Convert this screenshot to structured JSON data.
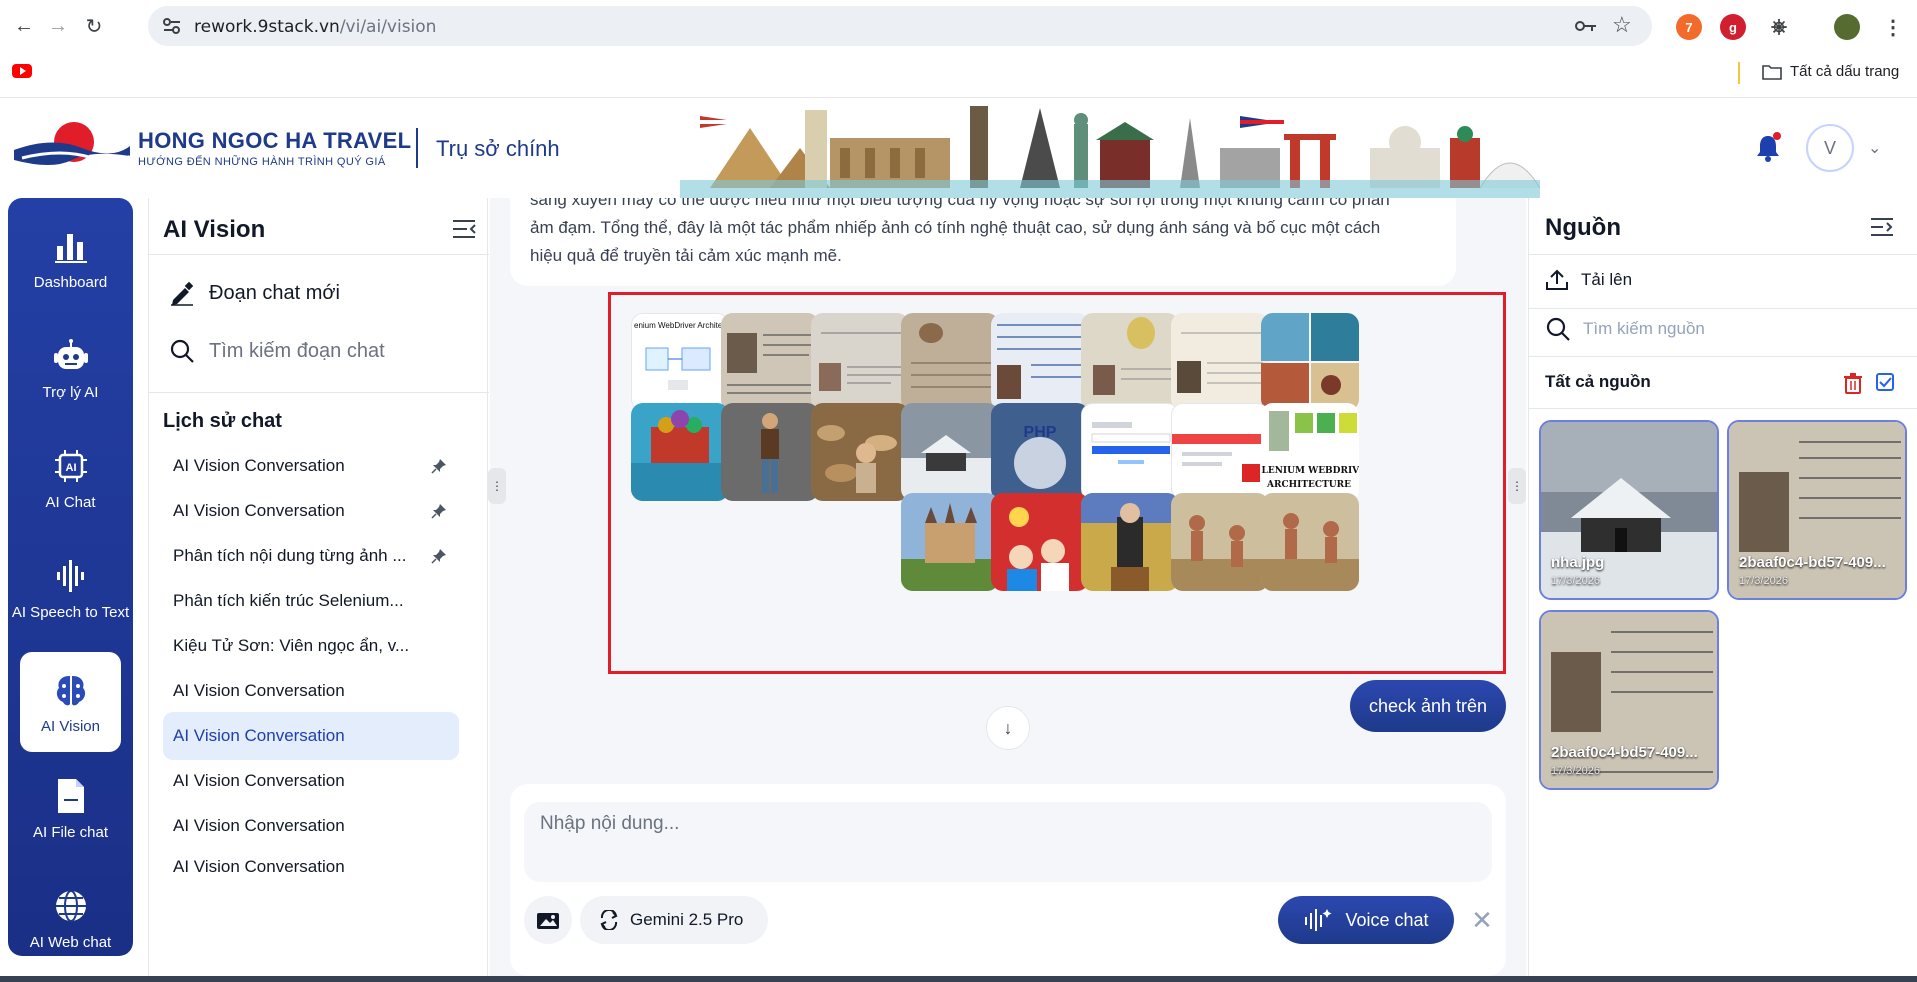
{
  "browser": {
    "url_host": "rework.9stack.vn",
    "url_path": "/vi/ai/vision",
    "bookmarks_all": "Tất cả dấu trang"
  },
  "header": {
    "brand_name": "HONG NGOC HA TRAVEL",
    "brand_tagline": "HƯỚNG ĐẾN NHỮNG HÀNH TRÌNH QUÝ GIÁ",
    "office": "Trụ sở chính",
    "avatar_initial": "V"
  },
  "leftnav": {
    "items": [
      {
        "label": "Dashboard",
        "icon": "bar-chart-icon"
      },
      {
        "label": "Trợ lý AI",
        "icon": "robot-icon"
      },
      {
        "label": "AI Chat",
        "icon": "ai-chip-icon"
      },
      {
        "label": "AI Speech to Text",
        "icon": "soundwave-icon"
      },
      {
        "label": "AI Vision",
        "icon": "brain-icon",
        "active": true
      },
      {
        "label": "AI File chat",
        "icon": "file-icon"
      },
      {
        "label": "AI Web chat",
        "icon": "globe-icon"
      }
    ]
  },
  "chatpanel": {
    "title": "AI Vision",
    "new_chat": "Đoạn chat mới",
    "search_placeholder": "Tìm kiếm đoạn chat",
    "history_title": "Lịch sử chat",
    "conversations": [
      "AI Vision Conversation",
      "AI Vision Conversation",
      "Phân tích nội dung từng ảnh ...",
      "Phân tích kiến trúc Selenium...",
      "Kiệu Tử Sơn: Viên ngọc ẩn, v...",
      "AI Vision Conversation",
      "AI Vision Conversation",
      "AI Vision Conversation",
      "AI Vision Conversation",
      "AI Vision Conversation"
    ]
  },
  "main": {
    "ai_message_line1": "sáng xuyên mây có thể được hiểu như một biểu tượng của hy vọng hoặc sự soi rọi trong một khung cảnh có phần",
    "ai_message_line2": "ảm đạm. Tổng thể, đây là một tác phẩm nhiếp ảnh có tính nghệ thuật cao, sử dụng ánh sáng và bố cục một cách",
    "ai_message_line3": "hiệu quả để truyền tải cảm xúc mạnh mẽ.",
    "thumb_text_selenium": "enium WebDriver Architect",
    "thumb_text_selenium2": "ELENIUM WEBDRIVI",
    "thumb_text_selenium3": "ARCHITECTURE",
    "thumb_text_php": "PHP",
    "user_message": "check ảnh trên",
    "composer_placeholder": "Nhập nội dung...",
    "model_label": "Gemini 2.5 Pro",
    "voice_label": "Voice chat"
  },
  "sources": {
    "title": "Nguồn",
    "upload": "Tải lên",
    "search_placeholder": "Tìm kiếm nguồn",
    "all_sources": "Tất cả nguồn",
    "files": [
      {
        "name": "nha.jpg",
        "date": "17/3/2026"
      },
      {
        "name": "2baaf0c4-bd57-409...",
        "date": "17/3/2026"
      },
      {
        "name": "2baaf0c4-bd57-409...",
        "date": "17/3/2026"
      }
    ]
  }
}
